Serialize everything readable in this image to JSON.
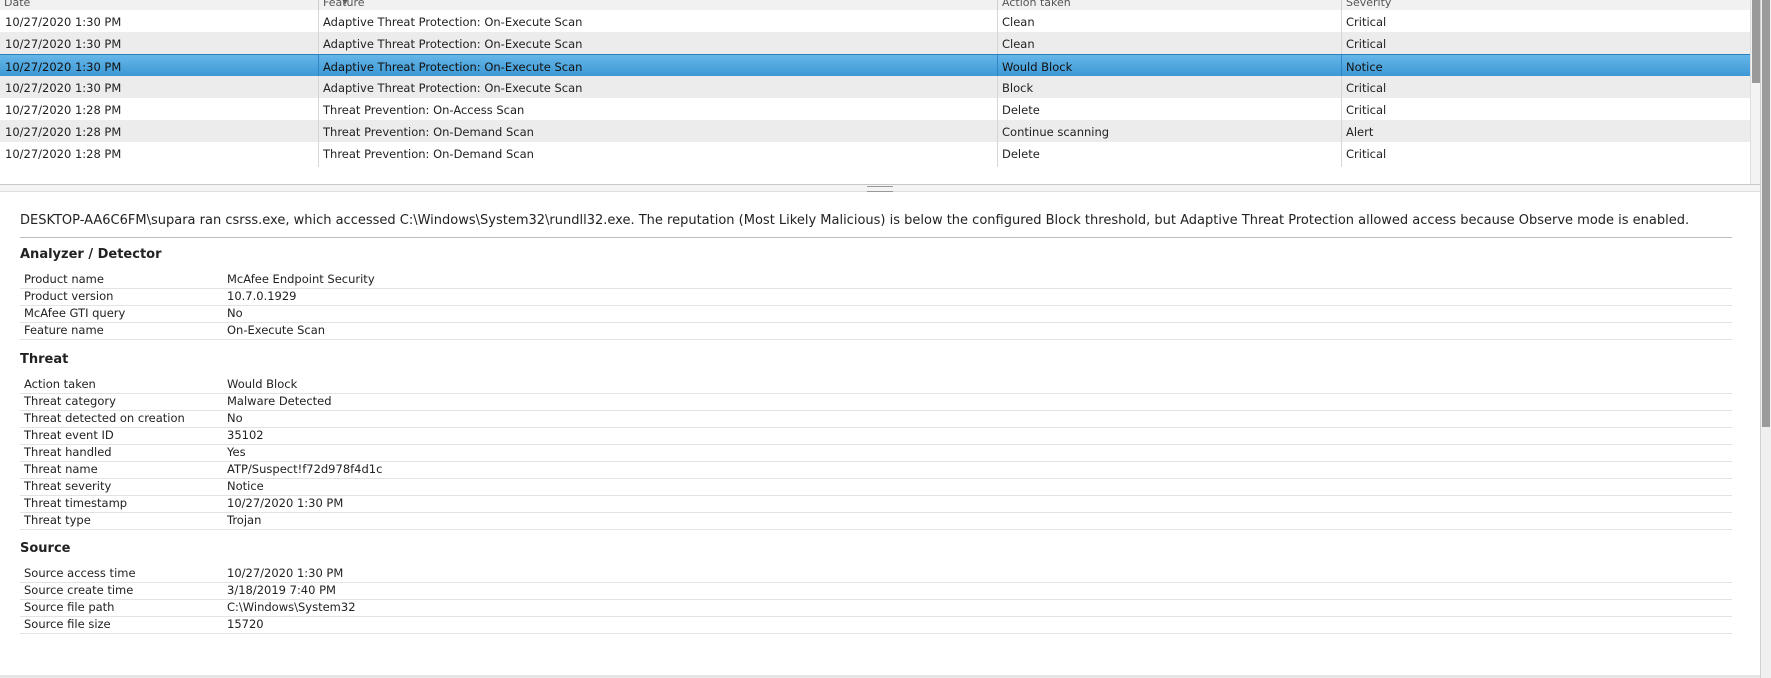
{
  "grid": {
    "columns": [
      "Date",
      "Feature",
      "Action taken",
      "Severity"
    ],
    "rows": [
      {
        "date": "10/27/2020 1:30 PM",
        "feature": "Adaptive Threat Protection: On-Execute Scan",
        "action": "Clean",
        "severity": "Critical",
        "selected": false
      },
      {
        "date": "10/27/2020 1:30 PM",
        "feature": "Adaptive Threat Protection: On-Execute Scan",
        "action": "Clean",
        "severity": "Critical",
        "selected": false
      },
      {
        "date": "10/27/2020 1:30 PM",
        "feature": "Adaptive Threat Protection: On-Execute Scan",
        "action": "Would Block",
        "severity": "Notice",
        "selected": true
      },
      {
        "date": "10/27/2020 1:30 PM",
        "feature": "Adaptive Threat Protection: On-Execute Scan",
        "action": "Block",
        "severity": "Critical",
        "selected": false
      },
      {
        "date": "10/27/2020 1:28 PM",
        "feature": "Threat Prevention: On-Access Scan",
        "action": "Delete",
        "severity": "Critical",
        "selected": false
      },
      {
        "date": "10/27/2020 1:28 PM",
        "feature": "Threat Prevention: On-Demand Scan",
        "action": "Continue scanning",
        "severity": "Alert",
        "selected": false
      },
      {
        "date": "10/27/2020 1:28 PM",
        "feature": "Threat Prevention: On-Demand Scan",
        "action": "Delete",
        "severity": "Critical",
        "selected": false
      }
    ]
  },
  "detail": {
    "summary": "DESKTOP-AA6C6FM\\supara ran csrss.exe, which accessed C:\\Windows\\System32\\rundll32.exe. The reputation (Most Likely Malicious) is below the configured Block threshold, but Adaptive Threat Protection allowed access because Observe mode is enabled.",
    "sections": [
      {
        "title": "Analyzer / Detector",
        "props": [
          {
            "key": "Product name",
            "value": "McAfee Endpoint Security"
          },
          {
            "key": "Product version",
            "value": "10.7.0.1929"
          },
          {
            "key": "McAfee GTI query",
            "value": "No"
          },
          {
            "key": "Feature name",
            "value": "On-Execute Scan"
          }
        ]
      },
      {
        "title": "Threat",
        "props": [
          {
            "key": "Action taken",
            "value": "Would Block"
          },
          {
            "key": "Threat category",
            "value": "Malware Detected"
          },
          {
            "key": "Threat detected on creation",
            "value": "No"
          },
          {
            "key": "Threat event ID",
            "value": "35102"
          },
          {
            "key": "Threat handled",
            "value": "Yes"
          },
          {
            "key": "Threat name",
            "value": "ATP/Suspect!f72d978f4d1c"
          },
          {
            "key": "Threat severity",
            "value": "Notice"
          },
          {
            "key": "Threat timestamp",
            "value": "10/27/2020 1:30 PM"
          },
          {
            "key": "Threat type",
            "value": "Trojan"
          }
        ]
      },
      {
        "title": "Source",
        "props": [
          {
            "key": "Source access time",
            "value": "10/27/2020 1:30 PM"
          },
          {
            "key": "Source create time",
            "value": "3/18/2019 7:40 PM"
          },
          {
            "key": "Source file path",
            "value": "C:\\Windows\\System32"
          },
          {
            "key": "Source file size",
            "value": "15720"
          }
        ]
      }
    ]
  },
  "colors": {
    "selected_row": "#4aa1d8",
    "alt_row": "#ececec",
    "scroll_thumb": "#9b9b9b"
  },
  "icons": {
    "sort": "sort-arrow-icon",
    "splitter": "splitter-grip-icon"
  }
}
